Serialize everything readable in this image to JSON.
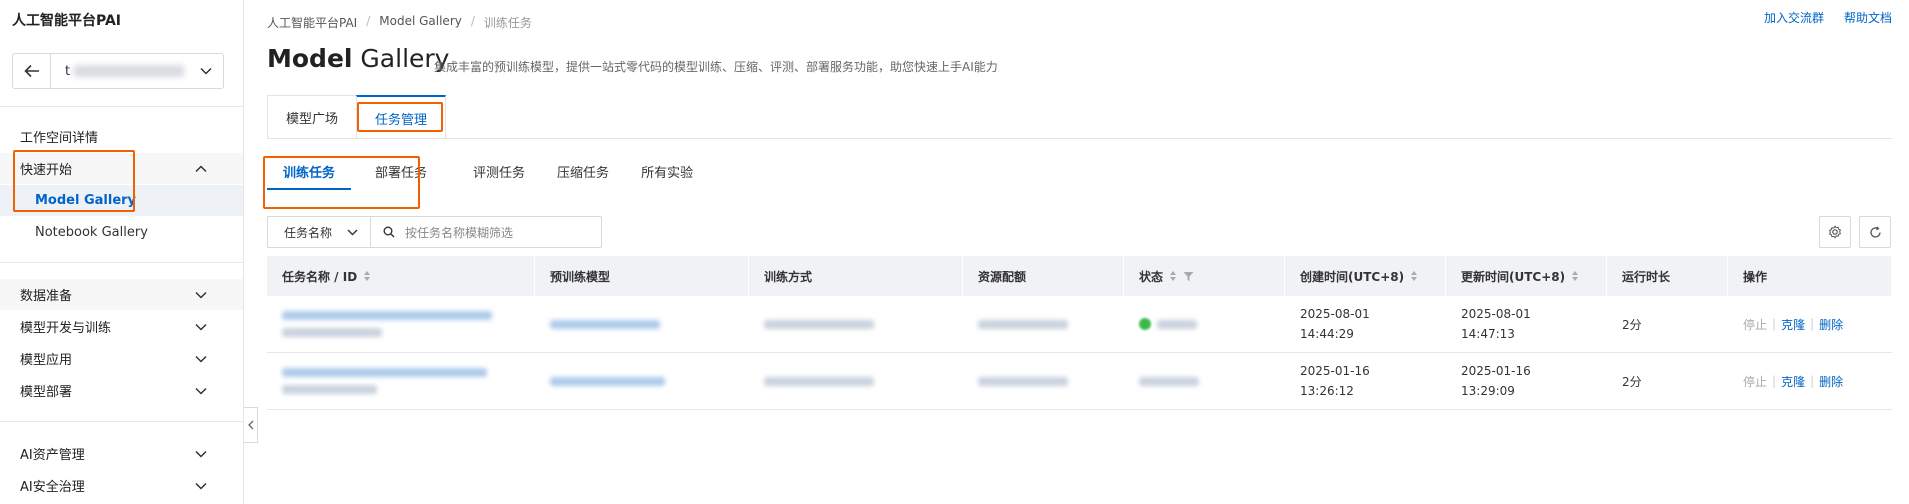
{
  "sidebar": {
    "app_title": "人工智能平台PAI",
    "workspace": {
      "prefix": "t"
    },
    "items": [
      {
        "label": "工作空间详情"
      },
      {
        "label": "快速开始"
      },
      {
        "label": "Model Gallery"
      },
      {
        "label": "Notebook Gallery"
      },
      {
        "label": "数据准备"
      },
      {
        "label": "模型开发与训练"
      },
      {
        "label": "模型应用"
      },
      {
        "label": "模型部署"
      },
      {
        "label": "AI资产管理"
      },
      {
        "label": "AI安全治理"
      }
    ]
  },
  "header": {
    "breadcrumb": [
      "人工智能平台PAI",
      "Model Gallery",
      "训练任务"
    ],
    "links": [
      "加入交流群",
      "帮助文档"
    ],
    "title_bold": "Model",
    "title_rest": " Gallery",
    "description": "集成丰富的预训练模型，提供一站式零代码的模型训练、压缩、评测、部署服务功能，助您快速上手AI能力"
  },
  "main_tabs": [
    "模型广场",
    "任务管理"
  ],
  "sub_tabs": [
    "训练任务",
    "部署任务",
    "评测任务",
    "压缩任务",
    "所有实验"
  ],
  "filter": {
    "select_value": "任务名称",
    "placeholder": "按任务名称模糊筛选"
  },
  "table": {
    "columns": [
      "任务名称 / ID",
      "预训练模型",
      "训练方式",
      "资源配额",
      "状态",
      "创建时间(UTC+8)",
      "更新时间(UTC+8)",
      "运行时长",
      "操作"
    ],
    "rows": [
      {
        "created_date": "2025-08-01",
        "created_time": "14:44:29",
        "updated_date": "2025-08-01",
        "updated_time": "14:47:13",
        "duration": "2分",
        "actions": [
          "停止",
          "克隆",
          "删除"
        ]
      },
      {
        "created_date": "2025-01-16",
        "created_time": "13:26:12",
        "updated_date": "2025-01-16",
        "updated_time": "13:29:09",
        "duration": "2分",
        "actions": [
          "停止",
          "克隆",
          "删除"
        ]
      }
    ]
  },
  "colors": {
    "accent": "#0064c8",
    "highlight": "#f06200",
    "success": "#3db94b"
  }
}
